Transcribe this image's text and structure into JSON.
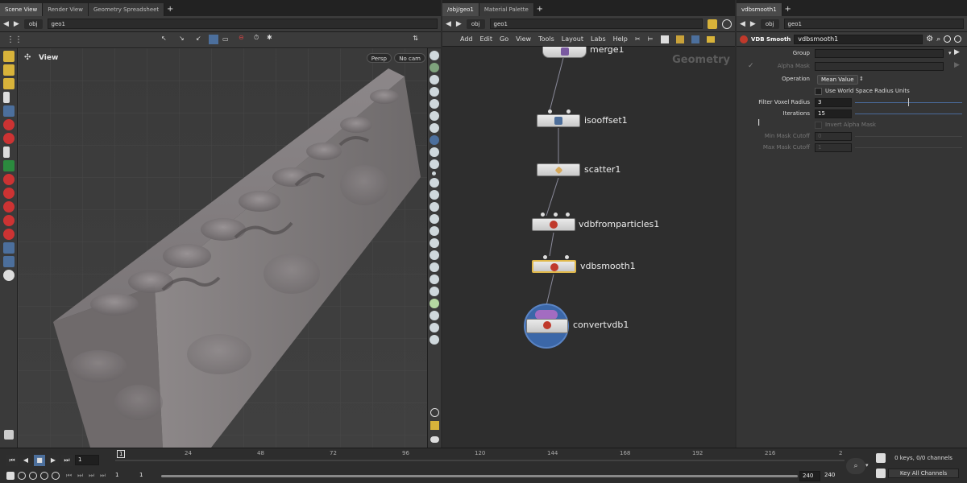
{
  "scene": {
    "tabs": [
      "Scene View",
      "Render View",
      "Geometry Spreadsheet"
    ],
    "path": [
      "obj",
      "geo1"
    ],
    "viewport_label": "View",
    "camera_mode": "Persp",
    "camera": "No cam"
  },
  "network": {
    "tabs": [
      "/obj/geo1",
      "Material Palette"
    ],
    "path": [
      "obj",
      "geo1"
    ],
    "menu": [
      "Add",
      "Edit",
      "Go",
      "View",
      "Tools",
      "Layout",
      "Labs",
      "Help"
    ],
    "context_title": "Geometry",
    "nodes": [
      {
        "name": "merge1"
      },
      {
        "name": "isooffset1"
      },
      {
        "name": "scatter1"
      },
      {
        "name": "vdbfromparticles1"
      },
      {
        "name": "vdbsmooth1"
      },
      {
        "name": "convertvdb1"
      }
    ]
  },
  "params": {
    "tab": "vdbsmooth1",
    "path": [
      "obj",
      "geo1"
    ],
    "node_type": "VDB Smooth",
    "node_name": "vdbsmooth1",
    "rows": {
      "group": {
        "label": "Group",
        "value": ""
      },
      "alpha_mask": {
        "label": "Alpha Mask",
        "value": ""
      },
      "operation": {
        "label": "Operation",
        "value": "Mean Value"
      },
      "world_space": {
        "label": "Use World Space Radius Units"
      },
      "filter_radius": {
        "label": "Filter Voxel Radius",
        "value": "3"
      },
      "iterations": {
        "label": "Iterations",
        "value": "15"
      },
      "invert_alpha": {
        "label": "Invert Alpha Mask"
      },
      "min_mask": {
        "label": "Min Mask Cutoff",
        "value": "0"
      },
      "max_mask": {
        "label": "Max Mask Cutoff",
        "value": "1"
      }
    }
  },
  "timeline": {
    "current_frame": "1",
    "start_frame": "1",
    "start_frame_2": "1",
    "ticks": [
      "24",
      "48",
      "72",
      "96",
      "120",
      "144",
      "168",
      "192",
      "216",
      "2"
    ],
    "end_frame": "240",
    "end_frame_2": "240",
    "marker": "1",
    "keys_status": "0 keys, 0/0 channels",
    "key_all_channels": "Key All Channels"
  },
  "colors": {
    "accent": "#e0b84a",
    "vdb_red": "#c0392b",
    "selected_blue": "#3a6ea5"
  }
}
